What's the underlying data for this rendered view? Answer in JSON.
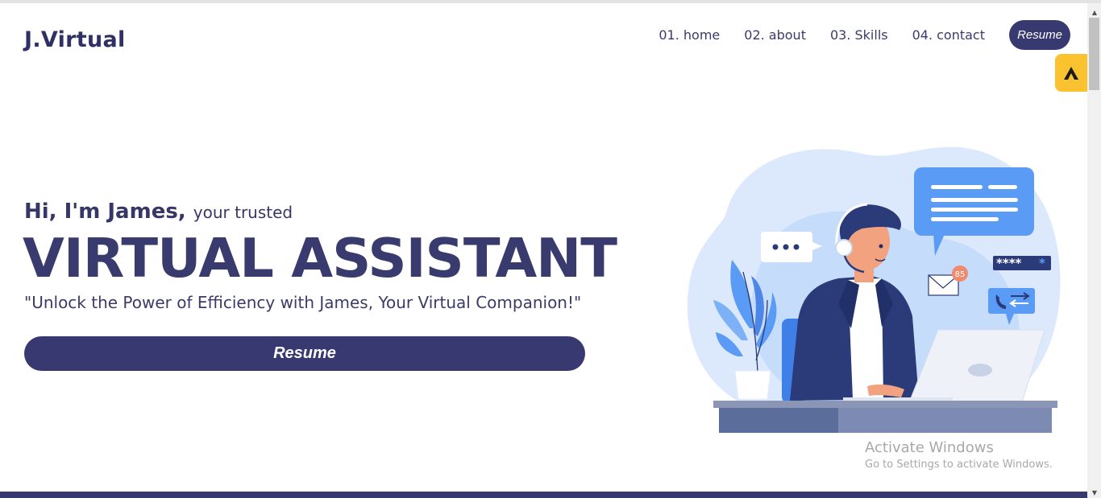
{
  "brand": {
    "logo": "J.Virtual"
  },
  "nav": {
    "items": [
      {
        "label": "01. home"
      },
      {
        "label": "02. about"
      },
      {
        "label": "03. Skills"
      },
      {
        "label": "04. contact"
      }
    ],
    "resume_label": "Resume"
  },
  "hero": {
    "greeting": "Hi, I'm James,",
    "greeting_sub": "your trusted",
    "headline": "VIRTUAL ASSISTANT",
    "tagline": "\"Unlock the Power of Efficiency with James, Your Virtual Companion!\"",
    "cta_label": "Resume"
  },
  "illustration": {
    "notification_count": "85",
    "password_mask": "****",
    "password_last": "*"
  },
  "extension": {
    "icon": "extension-icon"
  },
  "watermark": {
    "title": "Activate Windows",
    "subtitle": "Go to Settings to activate Windows."
  },
  "colors": {
    "primary": "#383970",
    "accent": "#f9c22e",
    "illustration_blue": "#5a9cf5"
  }
}
